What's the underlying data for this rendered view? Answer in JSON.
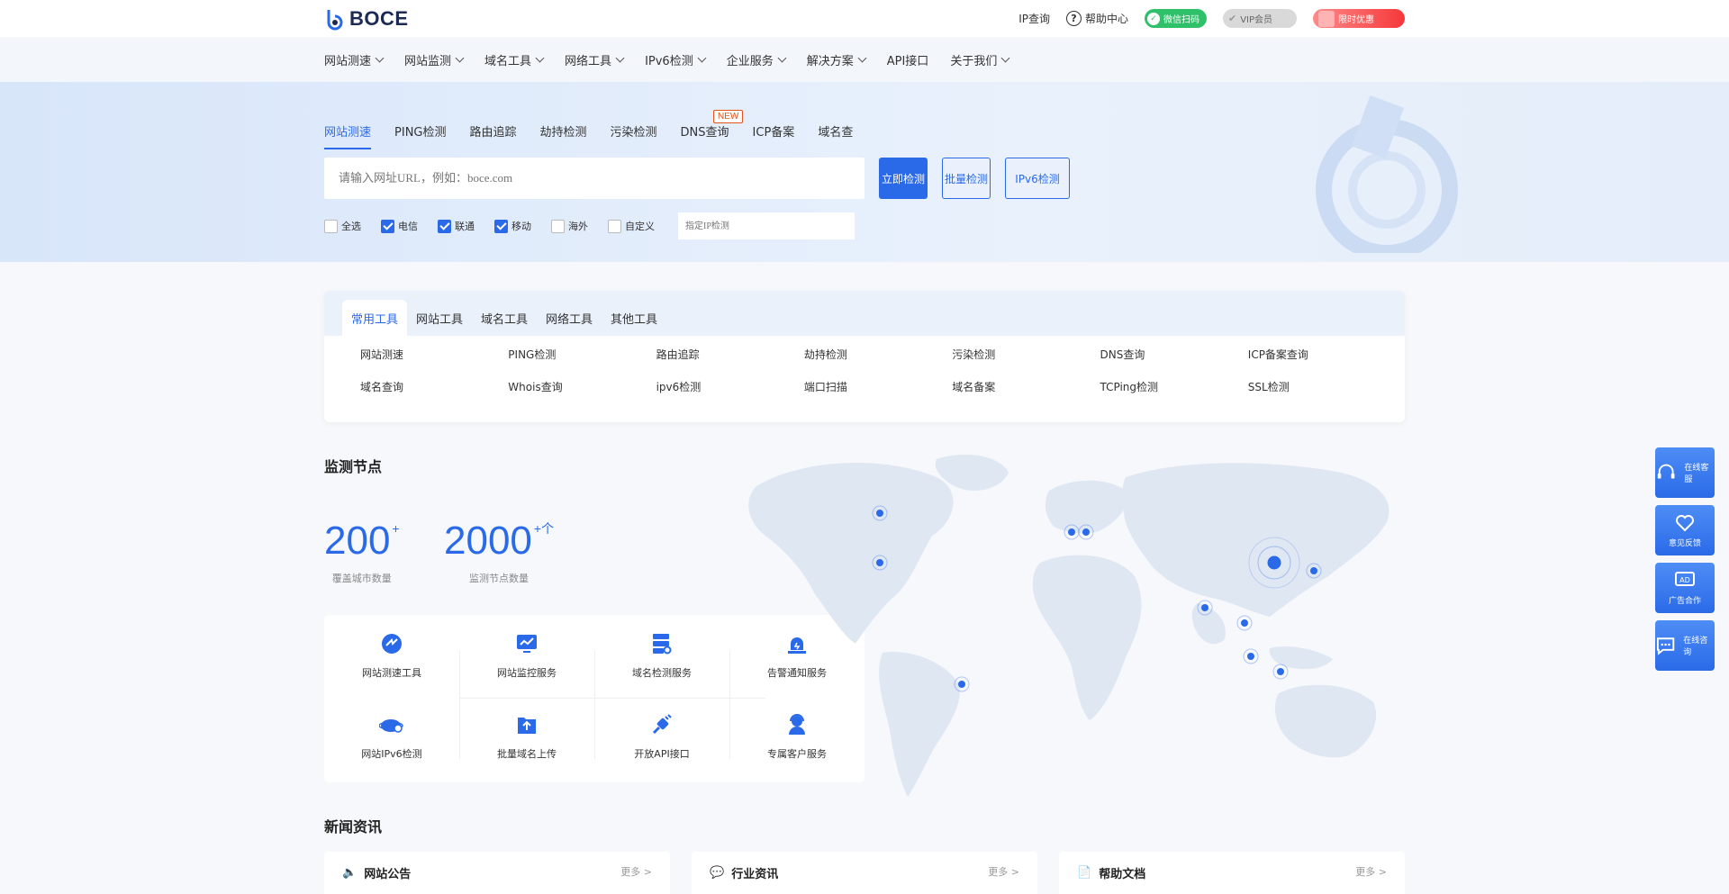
{
  "header": {
    "logo_text": "BOCE",
    "ip_link": "IP查询",
    "help_link": "帮助中心",
    "green_pill": "微信扫码",
    "vip_pill": "VIP会员",
    "promo_pill": "限时优惠"
  },
  "nav": {
    "items": [
      {
        "label": "网站测速",
        "dropdown": true
      },
      {
        "label": "网站监测",
        "dropdown": true
      },
      {
        "label": "域名工具",
        "dropdown": true
      },
      {
        "label": "网络工具",
        "dropdown": true
      },
      {
        "label": "IPv6检测",
        "dropdown": true
      },
      {
        "label": "企业服务",
        "dropdown": true
      },
      {
        "label": "解决方案",
        "dropdown": true
      },
      {
        "label": "API接口",
        "dropdown": false
      },
      {
        "label": "关于我们",
        "dropdown": true
      }
    ]
  },
  "hero": {
    "tabs": [
      "网站测速",
      "PING检测",
      "路由追踪",
      "劫持检测",
      "污染检测",
      "DNS查询",
      "ICP备案",
      "域名查"
    ],
    "new_badge": "NEW",
    "search_placeholder": "请输入网址URL，例如：boce.com",
    "btn_primary": "立即检测",
    "btn_secondary": "批量检测",
    "btn_ipv6": "IPv6检测",
    "checks": [
      {
        "label": "全选",
        "checked": false
      },
      {
        "label": "电信",
        "checked": true
      },
      {
        "label": "联通",
        "checked": true
      },
      {
        "label": "移动",
        "checked": true
      },
      {
        "label": "海外",
        "checked": false
      },
      {
        "label": "自定义",
        "checked": false
      }
    ],
    "ip_placeholder": "指定IP检测"
  },
  "tools": {
    "tabs": [
      "常用工具",
      "网站工具",
      "域名工具",
      "网络工具",
      "其他工具"
    ],
    "links": [
      "网站测速",
      "PING检测",
      "路由追踪",
      "劫持检测",
      "污染检测",
      "DNS查询",
      "ICP备案查询",
      "域名查询",
      "Whois查询",
      "ipv6检测",
      "端口扫描",
      "域名备案",
      "TCPing检测",
      "SSL检测"
    ]
  },
  "stats": {
    "title": "监测节点",
    "items": [
      {
        "value": "200",
        "sup": "+",
        "label": "覆盖城市数量"
      },
      {
        "value": "2000",
        "sup": "+个",
        "label": "监测节点数量"
      }
    ]
  },
  "features": [
    {
      "label": "网站测速工具",
      "icon": "speed-icon"
    },
    {
      "label": "网站监控服务",
      "icon": "monitor-icon"
    },
    {
      "label": "域名检测服务",
      "icon": "server-search-icon"
    },
    {
      "label": "告警通知服务",
      "icon": "alarm-icon"
    },
    {
      "label": "网站IPv6检测",
      "icon": "ipv6-cloud-icon"
    },
    {
      "label": "批量域名上传",
      "icon": "upload-folder-icon"
    },
    {
      "label": "开放API接口",
      "icon": "plug-icon"
    },
    {
      "label": "专属客户服务",
      "icon": "support-agent-icon"
    }
  ],
  "news": {
    "title": "新闻资讯",
    "cards": [
      {
        "title": "网站公告",
        "more": "更多 >",
        "icon": "megaphone-icon"
      },
      {
        "title": "行业资讯",
        "more": "更多 >",
        "icon": "chat-icon"
      },
      {
        "title": "帮助文档",
        "more": "更多 >",
        "icon": "document-icon"
      }
    ]
  },
  "side": [
    {
      "label": "在线客服",
      "icon": "headset-icon"
    },
    {
      "label": "意见反馈",
      "icon": "heart-hand-icon"
    },
    {
      "label": "广告合作",
      "icon": "ad-icon"
    },
    {
      "label": "在线咨询",
      "icon": "message-icon"
    }
  ],
  "colors": {
    "accent": "#2a6ae8",
    "green": "#2fc06a",
    "red": "#f5383b"
  }
}
